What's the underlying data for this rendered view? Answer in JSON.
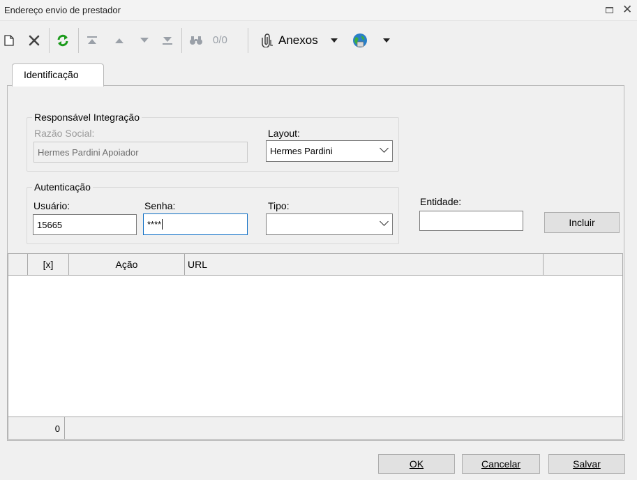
{
  "window": {
    "title": "Endereço envio de prestador"
  },
  "toolbar": {
    "counter": "0/0",
    "anexos_label": "Anexos",
    "icons": [
      "new-icon",
      "delete-icon",
      "refresh-icon",
      "first-record-icon",
      "previous-record-icon",
      "next-record-icon",
      "last-record-icon",
      "search-binoculars-icon",
      "attachment-icon",
      "dropdown-arrow-icon",
      "globe-icon",
      "dropdown-arrow-icon"
    ]
  },
  "tabs": [
    {
      "label": "Identificação",
      "active": true
    }
  ],
  "responsavel": {
    "legend": "Responsável Integração",
    "razao_label": "Razão Social:",
    "razao_value": "Hermes Pardini Apoiador",
    "layout_label": "Layout:",
    "layout_value": "Hermes Pardini"
  },
  "autenticacao": {
    "legend": "Autenticação",
    "usuario_label": "Usuário:",
    "usuario_value": "15665",
    "senha_label": "Senha:",
    "senha_value": "****",
    "tipo_label": "Tipo:",
    "tipo_value": ""
  },
  "entidade": {
    "label": "Entidade:",
    "value": "",
    "incluir_label": "Incluir"
  },
  "grid": {
    "columns": [
      "[x]",
      "Ação",
      "URL"
    ],
    "rows": [],
    "footer_count": "0"
  },
  "buttons": {
    "ok": "OK",
    "cancel": "Cancelar",
    "save": "Salvar"
  }
}
